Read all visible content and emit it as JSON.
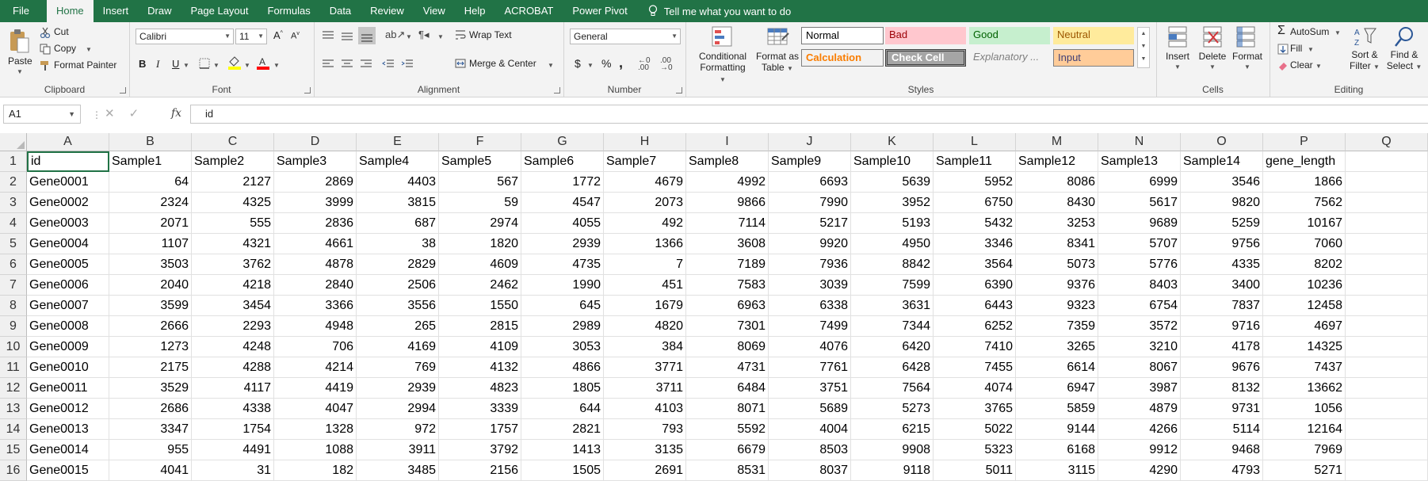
{
  "menu": {
    "tabs": [
      "File",
      "Home",
      "Insert",
      "Draw",
      "Page Layout",
      "Formulas",
      "Data",
      "Review",
      "View",
      "Help",
      "ACROBAT",
      "Power Pivot"
    ],
    "active": "Home",
    "tell_me": "Tell me what you want to do"
  },
  "ribbon": {
    "clipboard": {
      "paste": "Paste",
      "cut": "Cut",
      "copy": "Copy",
      "format_painter": "Format Painter",
      "name": "Clipboard"
    },
    "font": {
      "family": "Calibri",
      "size": "11",
      "name": "Font"
    },
    "alignment": {
      "wrap_text": "Wrap Text",
      "merge_center": "Merge & Center",
      "name": "Alignment"
    },
    "number": {
      "format": "General",
      "name": "Number"
    },
    "styles": {
      "conditional_formatting": [
        "Conditional",
        "Formatting"
      ],
      "format_as_table": [
        "Format as",
        "Table"
      ],
      "cells": [
        "Normal",
        "Bad",
        "Good",
        "Neutral",
        "Calculation",
        "Check Cell",
        "Explanatory ...",
        "Input"
      ],
      "name": "Styles"
    },
    "cells_group": {
      "insert": "Insert",
      "delete": "Delete",
      "format": "Format",
      "name": "Cells"
    },
    "editing": {
      "autosum": "AutoSum",
      "fill": "Fill",
      "clear": "Clear",
      "sort_filter": [
        "Sort &",
        "Filter"
      ],
      "find_select": [
        "Find &",
        "Select"
      ],
      "name": "Editing"
    }
  },
  "formula_bar": {
    "name_box": "A1",
    "content": "id"
  },
  "sheet": {
    "columns": [
      "A",
      "B",
      "C",
      "D",
      "E",
      "F",
      "G",
      "H",
      "I",
      "J",
      "K",
      "L",
      "M",
      "N",
      "O",
      "P",
      "Q"
    ],
    "row_numbers": [
      "1",
      "2",
      "3",
      "4",
      "5",
      "6",
      "7",
      "8",
      "9",
      "10",
      "11",
      "12",
      "13",
      "14",
      "15",
      "16"
    ],
    "rows": [
      [
        "id",
        "Sample1",
        "Sample2",
        "Sample3",
        "Sample4",
        "Sample5",
        "Sample6",
        "Sample7",
        "Sample8",
        "Sample9",
        "Sample10",
        "Sample11",
        "Sample12",
        "Sample13",
        "Sample14",
        "gene_length"
      ],
      [
        "Gene0001",
        "64",
        "2127",
        "2869",
        "4403",
        "567",
        "1772",
        "4679",
        "4992",
        "6693",
        "5639",
        "5952",
        "8086",
        "6999",
        "3546",
        "1866"
      ],
      [
        "Gene0002",
        "2324",
        "4325",
        "3999",
        "3815",
        "59",
        "4547",
        "2073",
        "9866",
        "7990",
        "3952",
        "6750",
        "8430",
        "5617",
        "9820",
        "7562"
      ],
      [
        "Gene0003",
        "2071",
        "555",
        "2836",
        "687",
        "2974",
        "4055",
        "492",
        "7114",
        "5217",
        "5193",
        "5432",
        "3253",
        "9689",
        "5259",
        "10167"
      ],
      [
        "Gene0004",
        "1107",
        "4321",
        "4661",
        "38",
        "1820",
        "2939",
        "1366",
        "3608",
        "9920",
        "4950",
        "3346",
        "8341",
        "5707",
        "9756",
        "7060"
      ],
      [
        "Gene0005",
        "3503",
        "3762",
        "4878",
        "2829",
        "4609",
        "4735",
        "7",
        "7189",
        "7936",
        "8842",
        "3564",
        "5073",
        "5776",
        "4335",
        "8202"
      ],
      [
        "Gene0006",
        "2040",
        "4218",
        "2840",
        "2506",
        "2462",
        "1990",
        "451",
        "7583",
        "3039",
        "7599",
        "6390",
        "9376",
        "8403",
        "3400",
        "10236"
      ],
      [
        "Gene0007",
        "3599",
        "3454",
        "3366",
        "3556",
        "1550",
        "645",
        "1679",
        "6963",
        "6338",
        "3631",
        "6443",
        "9323",
        "6754",
        "7837",
        "12458"
      ],
      [
        "Gene0008",
        "2666",
        "2293",
        "4948",
        "265",
        "2815",
        "2989",
        "4820",
        "7301",
        "7499",
        "7344",
        "6252",
        "7359",
        "3572",
        "9716",
        "4697"
      ],
      [
        "Gene0009",
        "1273",
        "4248",
        "706",
        "4169",
        "4109",
        "3053",
        "384",
        "8069",
        "4076",
        "6420",
        "7410",
        "3265",
        "3210",
        "4178",
        "14325"
      ],
      [
        "Gene0010",
        "2175",
        "4288",
        "4214",
        "769",
        "4132",
        "4866",
        "3771",
        "4731",
        "7761",
        "6428",
        "7455",
        "6614",
        "8067",
        "9676",
        "7437"
      ],
      [
        "Gene0011",
        "3529",
        "4117",
        "4419",
        "2939",
        "4823",
        "1805",
        "3711",
        "6484",
        "3751",
        "7564",
        "4074",
        "6947",
        "3987",
        "8132",
        "13662"
      ],
      [
        "Gene0012",
        "2686",
        "4338",
        "4047",
        "2994",
        "3339",
        "644",
        "4103",
        "8071",
        "5689",
        "5273",
        "3765",
        "5859",
        "4879",
        "9731",
        "1056"
      ],
      [
        "Gene0013",
        "3347",
        "1754",
        "1328",
        "972",
        "1757",
        "2821",
        "793",
        "5592",
        "4004",
        "6215",
        "5022",
        "9144",
        "4266",
        "5114",
        "12164"
      ],
      [
        "Gene0014",
        "955",
        "4491",
        "1088",
        "3911",
        "3792",
        "1413",
        "3135",
        "6679",
        "8503",
        "9908",
        "5323",
        "6168",
        "9912",
        "9468",
        "7969"
      ],
      [
        "Gene0015",
        "4041",
        "31",
        "182",
        "3485",
        "2156",
        "1505",
        "2691",
        "8531",
        "8037",
        "9118",
        "5011",
        "3115",
        "4290",
        "4793",
        "5271"
      ]
    ]
  },
  "colors": {
    "accent": "#217346",
    "bad_bg": "#ffc7ce",
    "good_bg": "#c6efce",
    "neutral_bg": "#ffeb9c",
    "input_bg": "#ffcc99"
  }
}
